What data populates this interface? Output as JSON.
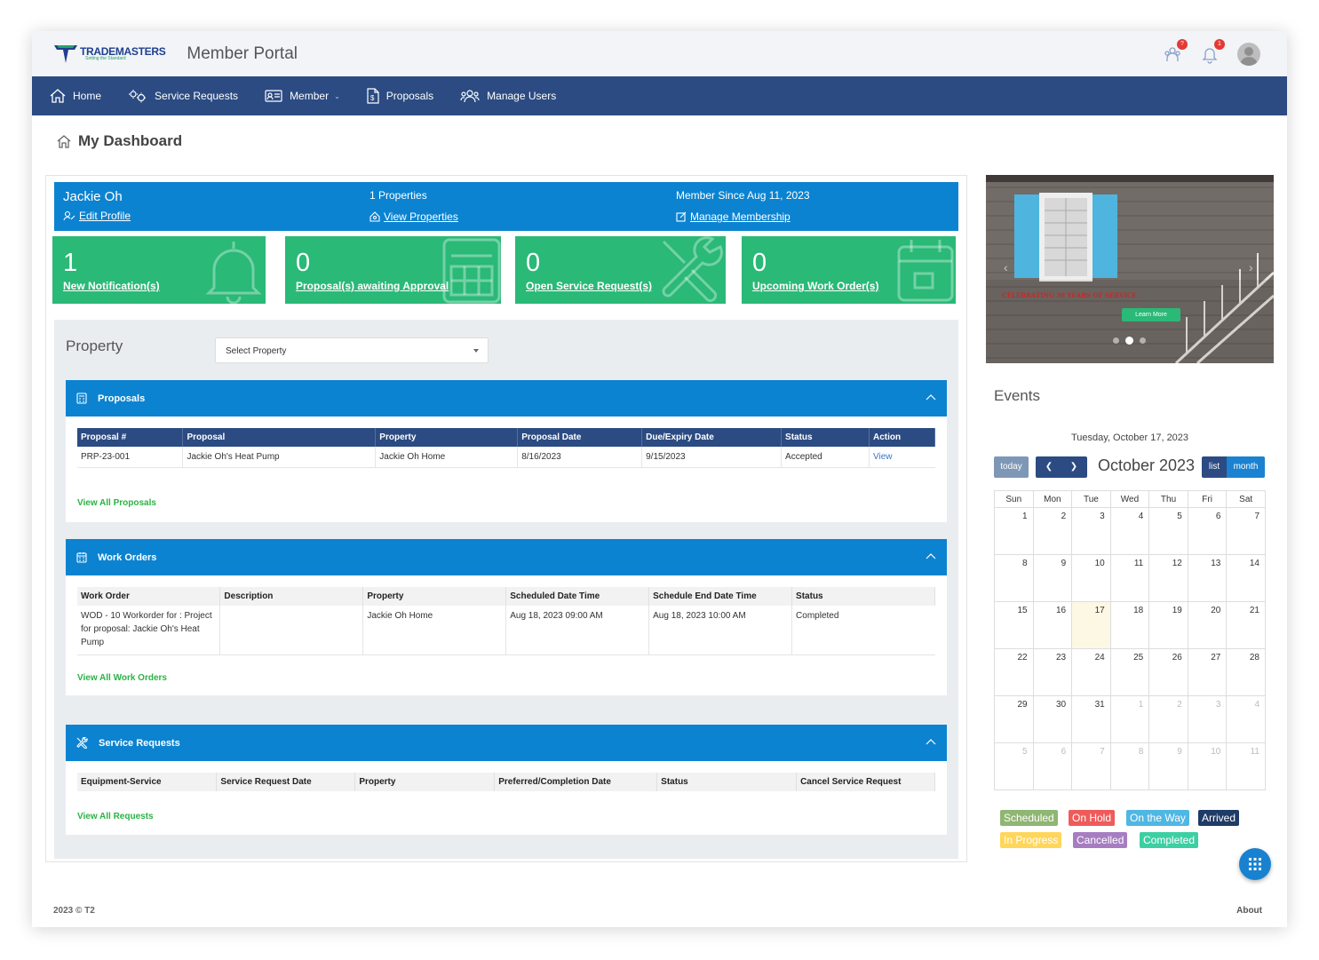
{
  "header": {
    "logo_name": "TRADEMASTERS",
    "logo_tagline": "Setting the Standard",
    "title": "Member Portal",
    "users_badge": "?",
    "notifications_badge": "1"
  },
  "nav": {
    "items": [
      {
        "label": "Home"
      },
      {
        "label": "Service Requests"
      },
      {
        "label": "Member"
      },
      {
        "label": "Proposals"
      },
      {
        "label": "Manage Users"
      }
    ]
  },
  "page": {
    "title": "My Dashboard"
  },
  "profile": {
    "name": "Jackie Oh",
    "edit_profile": "Edit Profile",
    "properties_count": "1 Properties",
    "view_properties": "View Properties",
    "member_since": "Member Since Aug 11, 2023",
    "manage_membership": "Manage Membership"
  },
  "tiles": [
    {
      "value": "1",
      "label": "New Notification(s)"
    },
    {
      "value": "0",
      "label": "Proposal(s) awaiting Approval"
    },
    {
      "value": "0",
      "label": "Open Service Request(s)"
    },
    {
      "value": "0",
      "label": "Upcoming Work Order(s)"
    }
  ],
  "property": {
    "label": "Property",
    "selected": "Select Property"
  },
  "proposals": {
    "title": "Proposals",
    "columns": [
      "Proposal #",
      "Proposal",
      "Property",
      "Proposal Date",
      "Due/Expiry Date",
      "Status",
      "Action"
    ],
    "rows": [
      [
        "PRP-23-001",
        "Jackie Oh's Heat Pump",
        "Jackie Oh Home",
        "8/16/2023",
        "9/15/2023",
        "Accepted",
        "View"
      ]
    ],
    "view_all": "View All Proposals"
  },
  "work_orders": {
    "title": "Work Orders",
    "columns": [
      "Work Order",
      "Description",
      "Property",
      "Scheduled Date Time",
      "Schedule End Date Time",
      "Status"
    ],
    "rows": [
      [
        "WOD - 10 Workorder for : Project for proposal: Jackie Oh's Heat Pump",
        "",
        "Jackie Oh Home",
        "Aug 18, 2023 09:00 AM",
        "Aug 18, 2023 10:00 AM",
        "Completed"
      ]
    ],
    "view_all": "View All Work Orders"
  },
  "service_requests": {
    "title": "Service Requests",
    "columns": [
      "Equipment-Service",
      "Service Request Date",
      "Property",
      "Preferred/Completion Date",
      "Status",
      "Cancel Service Request"
    ],
    "view_all": "View All Requests"
  },
  "carousel": {
    "caption": "CELEBRATING 30 YEARS OF SERVICE",
    "button": "Learn More",
    "slides": 3,
    "active_slide": 2
  },
  "events": {
    "title": "Events",
    "current_date": "Tuesday, October 17, 2023",
    "today_btn": "today",
    "month_title": "October 2023",
    "list_btn": "list",
    "month_btn": "month",
    "weekdays": [
      "Sun",
      "Mon",
      "Tue",
      "Wed",
      "Thu",
      "Fri",
      "Sat"
    ],
    "weeks": [
      [
        "1",
        "2",
        "3",
        "4",
        "5",
        "6",
        "7"
      ],
      [
        "8",
        "9",
        "10",
        "11",
        "12",
        "13",
        "14"
      ],
      [
        "15",
        "16",
        "17",
        "18",
        "19",
        "20",
        "21"
      ],
      [
        "22",
        "23",
        "24",
        "25",
        "26",
        "27",
        "28"
      ],
      [
        "29",
        "30",
        "31",
        "1",
        "2",
        "3",
        "4"
      ],
      [
        "5",
        "6",
        "7",
        "8",
        "9",
        "10",
        "11"
      ]
    ],
    "today": "17"
  },
  "legend": [
    {
      "label": "Scheduled",
      "color": "#8fb672"
    },
    {
      "label": "On Hold",
      "color": "#ef5b5b"
    },
    {
      "label": "On the Way",
      "color": "#4fb7e3"
    },
    {
      "label": "Arrived",
      "color": "#1f3b66"
    },
    {
      "label": "In Progress",
      "color": "#ffd65c"
    },
    {
      "label": "Cancelled",
      "color": "#a77dc2"
    },
    {
      "label": "Completed",
      "color": "#3ccfa2"
    }
  ],
  "footer": {
    "copyright": "2023 © T2",
    "about": "About"
  }
}
